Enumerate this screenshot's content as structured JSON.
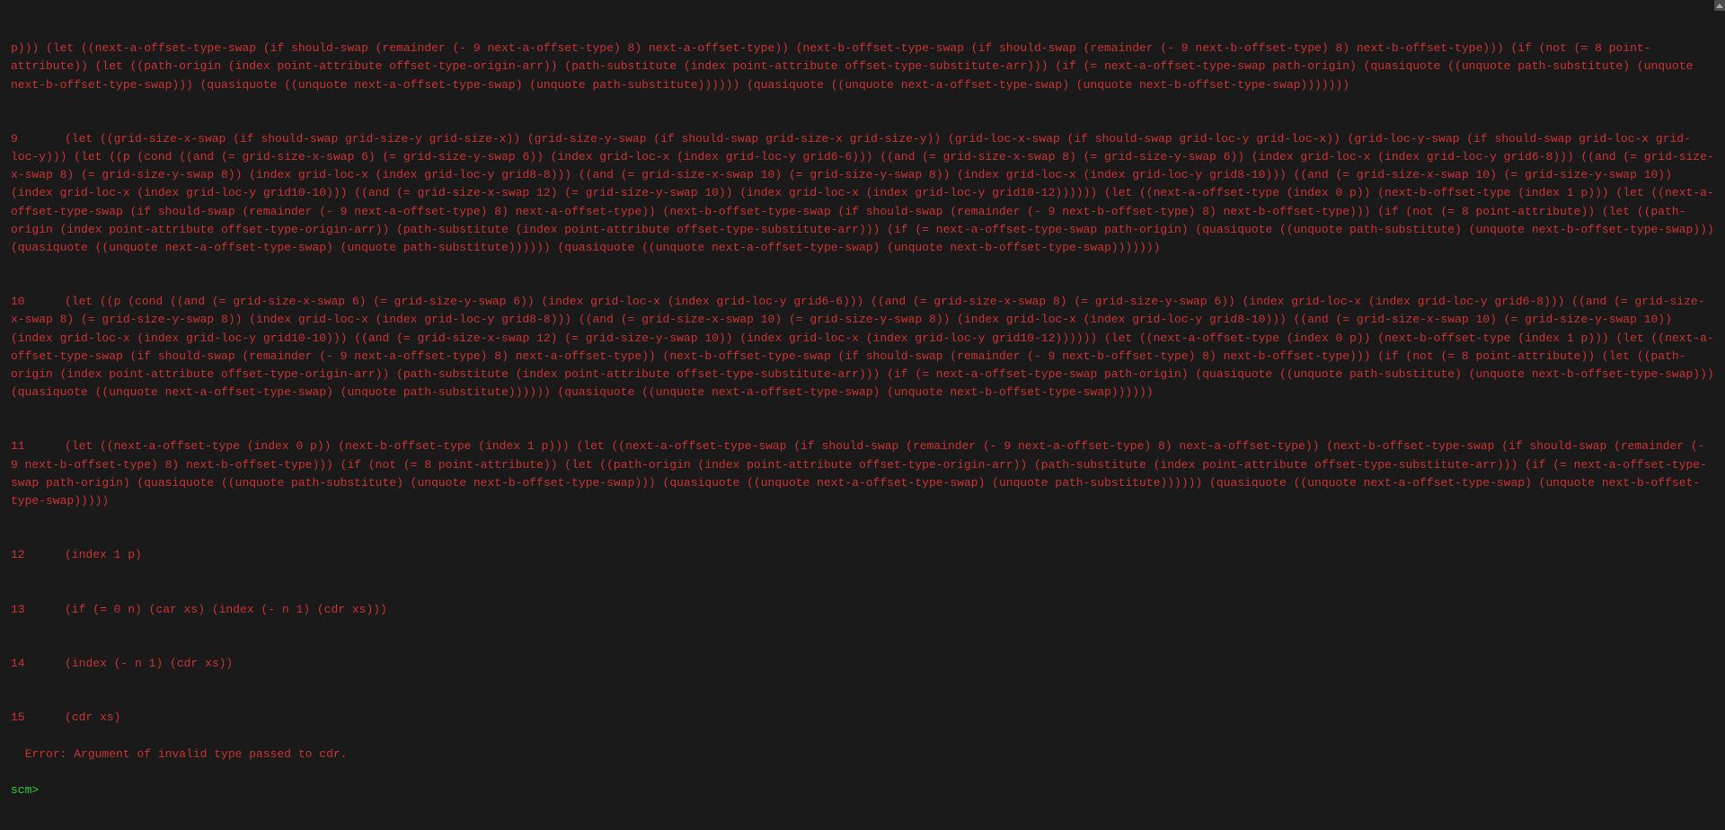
{
  "traceback": {
    "line0_text": "p))) (let ((next-a-offset-type-swap (if should-swap (remainder (- 9 next-a-offset-type) 8) next-a-offset-type)) (next-b-offset-type-swap (if should-swap (remainder (- 9 next-b-offset-type) 8) next-b-offset-type))) (if (not (= 8 point-attribute)) (let ((path-origin (index point-attribute offset-type-origin-arr)) (path-substitute (index point-attribute offset-type-substitute-arr))) (if (= next-a-offset-type-swap path-origin) (quasiquote ((unquote path-substitute) (unquote next-b-offset-type-swap))) (quasiquote ((unquote next-a-offset-type-swap) (unquote path-substitute)))))) (quasiquote ((unquote next-a-offset-type-swap) (unquote next-b-offset-type-swap)))))))",
    "line9_num": "9",
    "line9_text": "(let ((grid-size-x-swap (if should-swap grid-size-y grid-size-x)) (grid-size-y-swap (if should-swap grid-size-x grid-size-y)) (grid-loc-x-swap (if should-swap grid-loc-y grid-loc-x)) (grid-loc-y-swap (if should-swap grid-loc-x grid-loc-y))) (let ((p (cond ((and (= grid-size-x-swap 6) (= grid-size-y-swap 6)) (index grid-loc-x (index grid-loc-y grid6-6))) ((and (= grid-size-x-swap 8) (= grid-size-y-swap 6)) (index grid-loc-x (index grid-loc-y grid6-8))) ((and (= grid-size-x-swap 8) (= grid-size-y-swap 8)) (index grid-loc-x (index grid-loc-y grid8-8))) ((and (= grid-size-x-swap 10) (= grid-size-y-swap 8)) (index grid-loc-x (index grid-loc-y grid8-10))) ((and (= grid-size-x-swap 10) (= grid-size-y-swap 10)) (index grid-loc-x (index grid-loc-y grid10-10))) ((and (= grid-size-x-swap 12) (= grid-size-y-swap 10)) (index grid-loc-x (index grid-loc-y grid10-12)))))) (let ((next-a-offset-type (index 0 p)) (next-b-offset-type (index 1 p))) (let ((next-a-offset-type-swap (if should-swap (remainder (- 9 next-a-offset-type) 8) next-a-offset-type)) (next-b-offset-type-swap (if should-swap (remainder (- 9 next-b-offset-type) 8) next-b-offset-type))) (if (not (= 8 point-attribute)) (let ((path-origin (index point-attribute offset-type-origin-arr)) (path-substitute (index point-attribute offset-type-substitute-arr))) (if (= next-a-offset-type-swap path-origin) (quasiquote ((unquote path-substitute) (unquote next-b-offset-type-swap))) (quasiquote ((unquote next-a-offset-type-swap) (unquote path-substitute)))))) (quasiquote ((unquote next-a-offset-type-swap) (unquote next-b-offset-type-swap)))))))",
    "line10_num": "10",
    "line10_text": "(let ((p (cond ((and (= grid-size-x-swap 6) (= grid-size-y-swap 6)) (index grid-loc-x (index grid-loc-y grid6-6))) ((and (= grid-size-x-swap 8) (= grid-size-y-swap 6)) (index grid-loc-x (index grid-loc-y grid6-8))) ((and (= grid-size-x-swap 8) (= grid-size-y-swap 8)) (index grid-loc-x (index grid-loc-y grid8-8))) ((and (= grid-size-x-swap 10) (= grid-size-y-swap 8)) (index grid-loc-x (index grid-loc-y grid8-10))) ((and (= grid-size-x-swap 10) (= grid-size-y-swap 10)) (index grid-loc-x (index grid-loc-y grid10-10))) ((and (= grid-size-x-swap 12) (= grid-size-y-swap 10)) (index grid-loc-x (index grid-loc-y grid10-12)))))) (let ((next-a-offset-type (index 0 p)) (next-b-offset-type (index 1 p))) (let ((next-a-offset-type-swap (if should-swap (remainder (- 9 next-a-offset-type) 8) next-a-offset-type)) (next-b-offset-type-swap (if should-swap (remainder (- 9 next-b-offset-type) 8) next-b-offset-type))) (if (not (= 8 point-attribute)) (let ((path-origin (index point-attribute offset-type-origin-arr)) (path-substitute (index point-attribute offset-type-substitute-arr))) (if (= next-a-offset-type-swap path-origin) (quasiquote ((unquote path-substitute) (unquote next-b-offset-type-swap))) (quasiquote ((unquote next-a-offset-type-swap) (unquote path-substitute)))))) (quasiquote ((unquote next-a-offset-type-swap) (unquote next-b-offset-type-swap))))))",
    "line11_num": "11",
    "line11_text": "(let ((next-a-offset-type (index 0 p)) (next-b-offset-type (index 1 p))) (let ((next-a-offset-type-swap (if should-swap (remainder (- 9 next-a-offset-type) 8) next-a-offset-type)) (next-b-offset-type-swap (if should-swap (remainder (- 9 next-b-offset-type) 8) next-b-offset-type))) (if (not (= 8 point-attribute)) (let ((path-origin (index point-attribute offset-type-origin-arr)) (path-substitute (index point-attribute offset-type-substitute-arr))) (if (= next-a-offset-type-swap path-origin) (quasiquote ((unquote path-substitute) (unquote next-b-offset-type-swap))) (quasiquote ((unquote next-a-offset-type-swap) (unquote path-substitute)))))) (quasiquote ((unquote next-a-offset-type-swap) (unquote next-b-offset-type-swap)))))",
    "line12_num": "12",
    "line12_text": "(index 1 p)",
    "line13_num": "13",
    "line13_text": "(if (= 0 n) (car xs) (index (- n 1) (cdr xs)))",
    "line14_num": "14",
    "line14_text": "(index (- n 1) (cdr xs))",
    "line15_num": "15",
    "line15_text": "(cdr xs)"
  },
  "error": "Error: Argument of invalid type passed to cdr.",
  "prompt": "scm>"
}
